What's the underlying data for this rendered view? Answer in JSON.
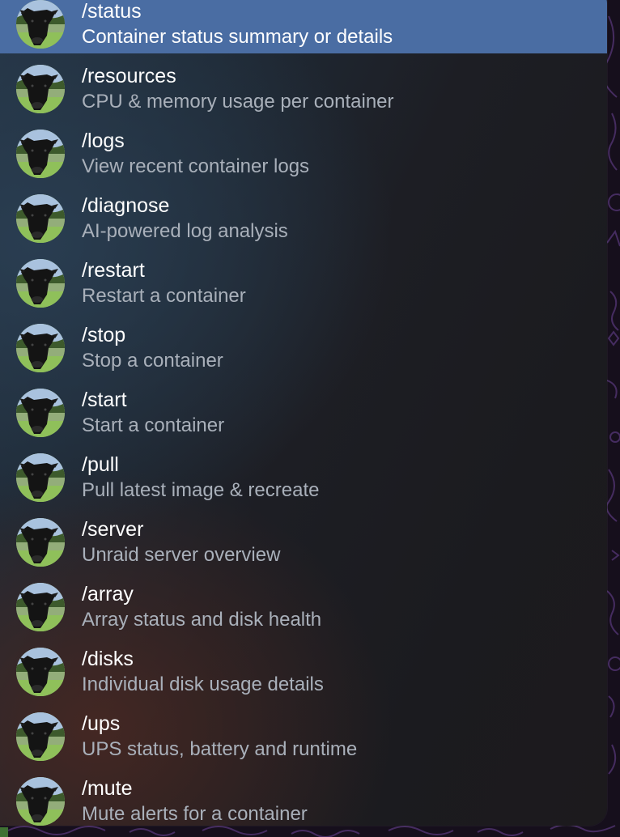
{
  "panel": {
    "name": "bot-command-suggestions",
    "selected_index": 0,
    "avatar_icon": "cow-avatar-icon",
    "selection_color": "#4a6da3",
    "commands": [
      {
        "command": "/status",
        "description": "Container status summary or details"
      },
      {
        "command": "/resources",
        "description": "CPU & memory usage per container"
      },
      {
        "command": "/logs",
        "description": "View recent container logs"
      },
      {
        "command": "/diagnose",
        "description": "AI-powered log analysis"
      },
      {
        "command": "/restart",
        "description": "Restart a container"
      },
      {
        "command": "/stop",
        "description": "Stop a container"
      },
      {
        "command": "/start",
        "description": "Start a container"
      },
      {
        "command": "/pull",
        "description": "Pull latest image & recreate"
      },
      {
        "command": "/server",
        "description": "Unraid server overview"
      },
      {
        "command": "/array",
        "description": "Array status and disk health"
      },
      {
        "command": "/disks",
        "description": "Individual disk usage details"
      },
      {
        "command": "/ups",
        "description": "UPS status, battery and runtime"
      },
      {
        "command": "/mute",
        "description": "Mute alerts for a container"
      }
    ]
  }
}
